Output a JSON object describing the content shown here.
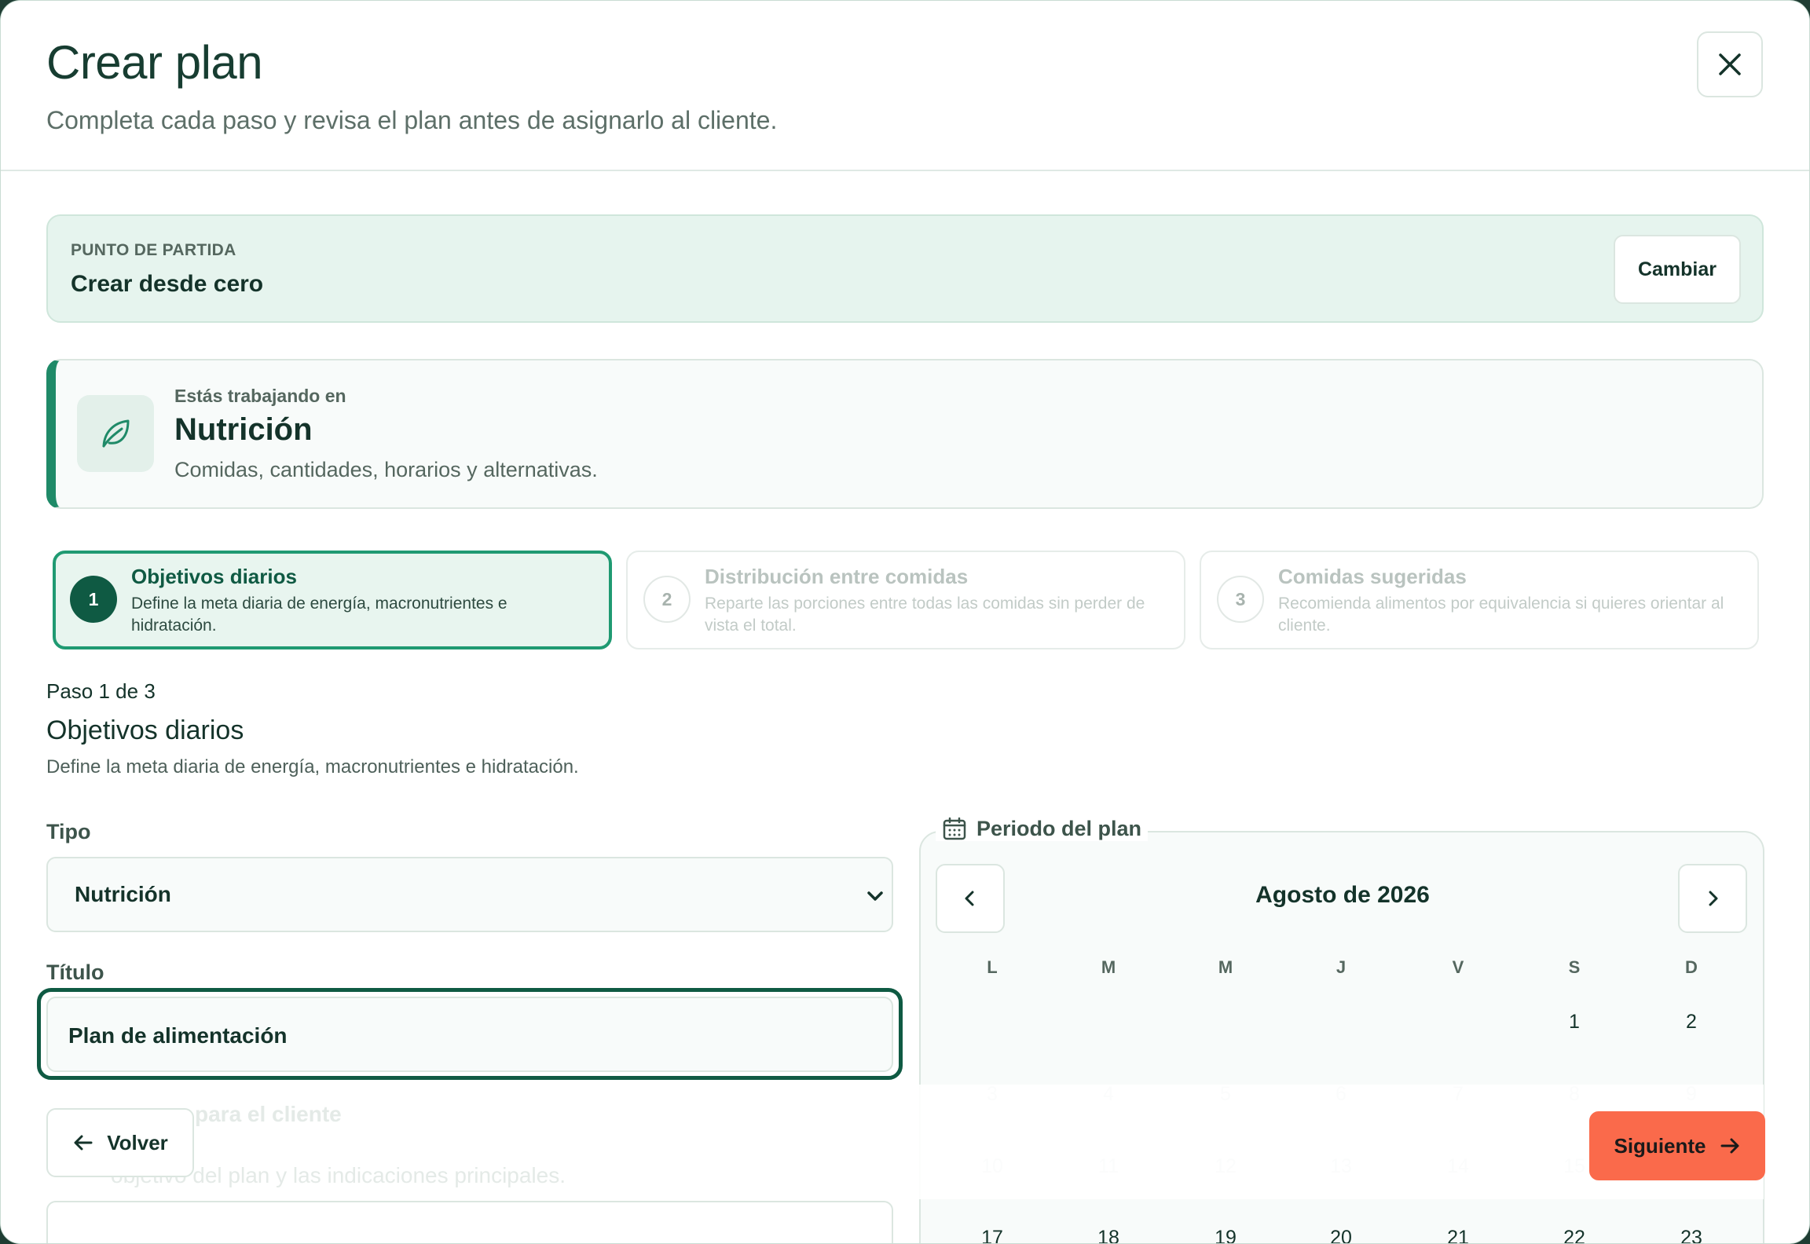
{
  "header": {
    "title": "Crear plan",
    "subtitle": "Completa cada paso y revisa el plan antes de asignarlo al cliente.",
    "close_icon": "close-icon"
  },
  "starting_point": {
    "label": "PUNTO DE PARTIDA",
    "value": "Crear desde cero",
    "change_label": "Cambiar"
  },
  "area": {
    "kicker": "Estás trabajando en",
    "title": "Nutrición",
    "description": "Comidas, cantidades, horarios y alternativas.",
    "icon": "leaf-icon"
  },
  "steps": [
    {
      "number": "1",
      "title": "Objetivos diarios",
      "description": "Define la meta diaria de energía, macronutrientes e hidratación.",
      "active": true
    },
    {
      "number": "2",
      "title": "Distribución entre comidas",
      "description": "Reparte las porciones entre todas las comidas sin perder de vista el total.",
      "active": false
    },
    {
      "number": "3",
      "title": "Comidas sugeridas",
      "description": "Recomienda alimentos por equivalencia si quieres orientar al cliente.",
      "active": false
    }
  ],
  "current_step": {
    "counter": "Paso 1 de 3",
    "title": "Objetivos diarios",
    "description": "Define la meta diaria de energía, macronutrientes e hidratación."
  },
  "form": {
    "type_label": "Tipo",
    "type_value": "Nutrición",
    "title_label": "Título",
    "title_value": "Plan de alimentación",
    "hidden_label": "para el cliente",
    "hidden_hint": "objetivo del plan y las indicaciones principales."
  },
  "calendar": {
    "legend": "Periodo del plan",
    "month": "Agosto de 2026",
    "weekdays": [
      "L",
      "M",
      "M",
      "J",
      "V",
      "S",
      "D"
    ],
    "week1": [
      "1",
      "2"
    ],
    "week2": [
      "3",
      "4",
      "5",
      "6",
      "7",
      "8",
      "9"
    ],
    "week3": [
      "10",
      "11",
      "12",
      "13",
      "14",
      "15",
      "16"
    ],
    "week4": [
      "17",
      "18",
      "19",
      "20",
      "21",
      "22",
      "23"
    ]
  },
  "footer": {
    "back_label": "Volver",
    "next_label": "Siguiente"
  },
  "colors": {
    "primary": "#0f5a43",
    "accent": "#1f9a72",
    "cta": "#fa6a4b",
    "soft_bg": "#e6f4ee"
  }
}
